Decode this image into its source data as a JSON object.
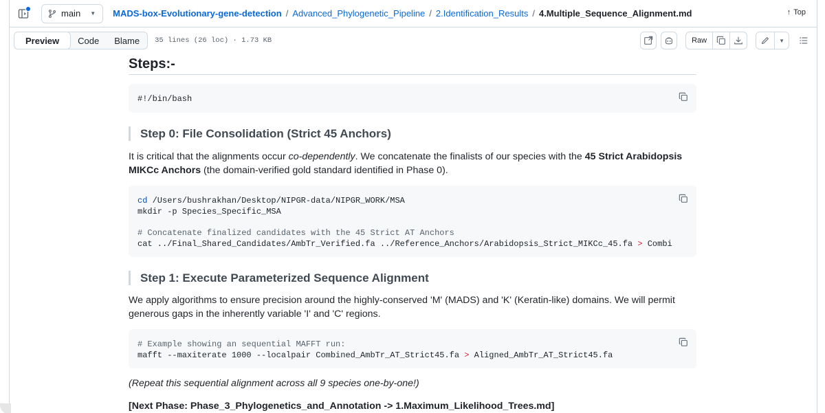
{
  "header": {
    "branch": "main",
    "breadcrumbs": [
      "MADS-box-Evolutionary-gene-detection",
      "Advanced_Phylogenetic_Pipeline",
      "2.Identification_Results"
    ],
    "current_file": "4.Multiple_Sequence_Alignment.md",
    "separator": "/",
    "top_label": "Top"
  },
  "toolbar": {
    "tabs": [
      "Preview",
      "Code",
      "Blame"
    ],
    "active_tab": "Preview",
    "file_info": "35 lines (26 loc) · 1.73 KB",
    "raw_label": "Raw"
  },
  "doc": {
    "heading": "Steps:-",
    "code1": "#!/bin/bash",
    "step0_title": "Step 0: File Consolidation (Strict 45 Anchors)",
    "step0_p_a": "It is critical that the alignments occur ",
    "step0_p_em": "co-dependently",
    "step0_p_b": ". We concatenate the finalists of our species with the ",
    "step0_p_strong": "45 Strict Arabidopsis MIKCc Anchors",
    "step0_p_c": " (the domain-verified gold standard identified in Phase 0).",
    "code2": {
      "line1_cmd": "cd",
      "line1_rest": " /Users/bushrakhan/Desktop/NIPGR-data/NIPGR_WORK/MSA",
      "line2": "mkdir -p Species_Specific_MSA",
      "line4": "# Concatenate finalized candidates with the 45 Strict AT Anchors",
      "line5_a": "cat ../Final_Shared_Candidates/AmbTr_Verified.fa ../Reference_Anchors/Arabidopsis_Strict_MIKCc_45.fa ",
      "line5_op": ">",
      "line5_b": " Combined_Ai"
    },
    "step1_title": "Step 1: Execute Parameterized Sequence Alignment",
    "step1_p": "We apply algorithms to ensure precision around the highly-conserved 'M' (MADS) and 'K' (Keratin-like) domains. We will permit generous gaps in the inherently variable 'I' and 'C' regions.",
    "code3": {
      "line1": "# Example showing an sequential MAFFT run:",
      "line2_a": "mafft --maxiterate 1000 --localpair Combined_AmbTr_AT_Strict45.fa ",
      "line2_op": ">",
      "line2_b": " Aligned_AmbTr_AT_Strict45.fa"
    },
    "repeat_note": "(Repeat this sequential alignment across all 9 species one-by-one!)",
    "next_phase": "[Next Phase: Phase_3_Phylogenetics_and_Annotation -> 1.Maximum_Likelihood_Trees.md]"
  }
}
